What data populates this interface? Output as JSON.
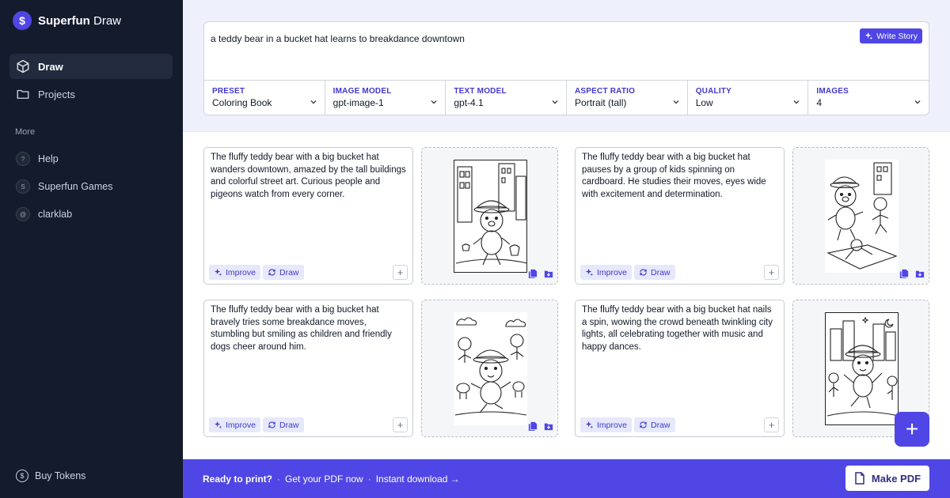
{
  "brand": {
    "logo_glyph": "$",
    "name_bold": "Superfun",
    "name_rest": " Draw"
  },
  "nav": {
    "items": [
      {
        "label": "Draw",
        "icon": "cube-icon",
        "active": true
      },
      {
        "label": "Projects",
        "icon": "folder-icon",
        "active": false
      }
    ]
  },
  "more": {
    "label": "More",
    "items": [
      {
        "label": "Help",
        "badge": "?"
      },
      {
        "label": "Superfun Games",
        "badge": "S"
      },
      {
        "label": "clarklab",
        "badge": "@"
      }
    ]
  },
  "buy_tokens": {
    "label": "Buy Tokens",
    "icon": "coin-icon"
  },
  "prompt": {
    "text": "a teddy bear in a bucket hat learns to breakdance downtown",
    "write_story_label": "Write Story"
  },
  "options": [
    {
      "label": "PRESET",
      "value": "Coloring Book"
    },
    {
      "label": "IMAGE MODEL",
      "value": "gpt-image-1"
    },
    {
      "label": "TEXT MODEL",
      "value": "gpt-4.1"
    },
    {
      "label": "ASPECT RATIO",
      "value": "Portrait (tall)"
    },
    {
      "label": "QUALITY",
      "value": "Low"
    },
    {
      "label": "IMAGES",
      "value": "4"
    }
  ],
  "pages": [
    {
      "text": "The fluffy teddy bear with a big bucket hat wanders downtown, amazed by the tall buildings and colorful street art. Curious people and pigeons watch from every corner."
    },
    {
      "text": "The fluffy teddy bear with a big bucket hat pauses by a group of kids spinning on cardboard. He studies their moves, eyes wide with excitement and determination."
    },
    {
      "text": "The fluffy teddy bear with a big bucket hat bravely tries some breakdance moves, stumbling but smiling as children and friendly dogs cheer around him."
    },
    {
      "text": "The fluffy teddy bear with a big bucket hat nails a spin, wowing the crowd beneath twinkling city lights, all celebrating together with music and happy dances."
    }
  ],
  "card_buttons": {
    "improve": "Improve",
    "draw": "Draw"
  },
  "fab_label": "+",
  "footer": {
    "ready": "Ready to print?",
    "get_pdf": "Get your PDF now",
    "instant": "Instant download →",
    "make_pdf": "Make PDF"
  },
  "colors": {
    "accent": "#4f46e5",
    "sidebar": "#141b2d",
    "header": "#eef0fb"
  }
}
